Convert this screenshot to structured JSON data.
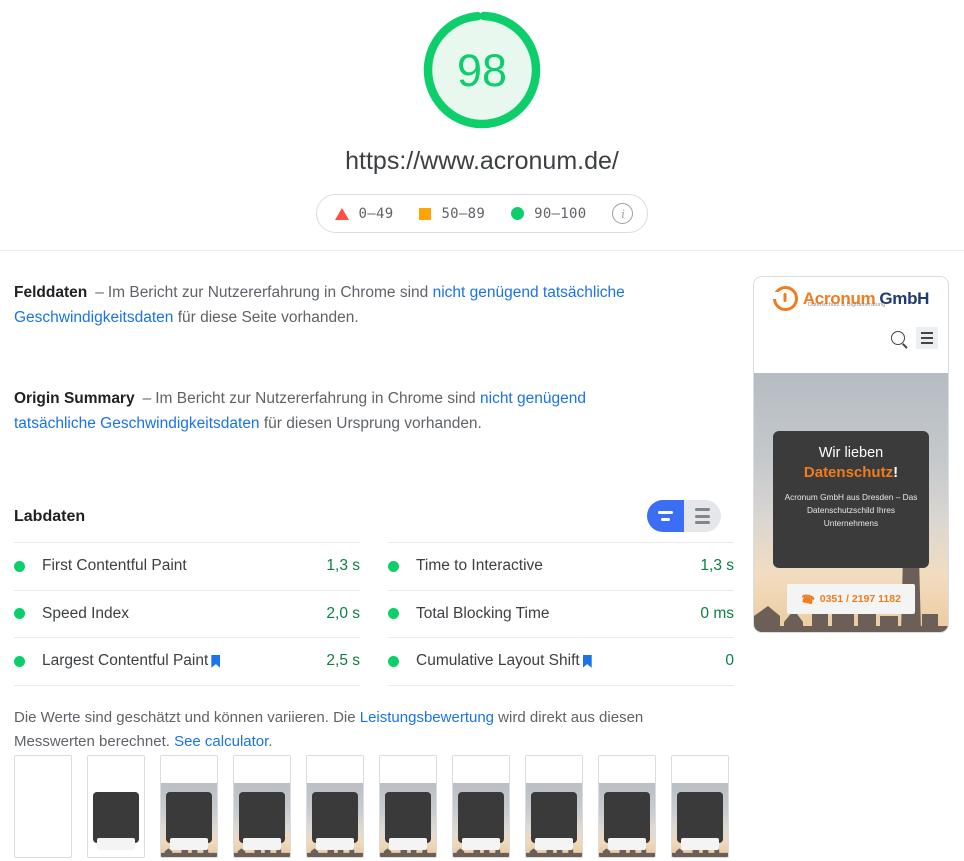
{
  "header": {
    "score": "98",
    "score_color": "#0cce6b",
    "score_bg": "#e8f8ef",
    "url": "https://www.acronum.de/",
    "legend": [
      {
        "icon": "triangle-red-icon",
        "label": "0–49",
        "color": "#ff4e42"
      },
      {
        "icon": "square-orange-icon",
        "label": "50–89",
        "color": "#ffa400"
      },
      {
        "icon": "circle-green-icon",
        "label": "90–100",
        "color": "#0cce6b"
      }
    ],
    "info_icon": "i"
  },
  "field_data": {
    "title": "Felddaten",
    "dash": "–",
    "text_1": "Im Bericht zur Nutzererfahrung in Chrome sind ",
    "link_1": "nicht genügend tatsächliche Geschwindigkeitsdaten",
    "text_2": " für diese Seite vorhanden."
  },
  "origin_summary": {
    "title": "Origin Summary",
    "dash": "–",
    "text_1": "Im Bericht zur Nutzererfahrung in Chrome sind ",
    "link_1": "nicht genügend tatsächliche Geschwindigkeitsdaten",
    "text_2": " für diesen Ursprung vorhanden."
  },
  "lab_data": {
    "title": "Labdaten",
    "toggle": {
      "active": "compact-view",
      "left_label": "compact-view-toggle",
      "right_label": "expanded-view-toggle"
    },
    "metrics_left": [
      {
        "name": "First Contentful Paint",
        "value": "1,3 s",
        "status": "green",
        "bookmark": false
      },
      {
        "name": "Speed Index",
        "value": "2,0 s",
        "status": "green",
        "bookmark": false
      },
      {
        "name": "Largest Contentful Paint",
        "value": "2,5 s",
        "status": "green",
        "bookmark": true
      }
    ],
    "metrics_right": [
      {
        "name": "Time to Interactive",
        "value": "1,3 s",
        "status": "green",
        "bookmark": false
      },
      {
        "name": "Total Blocking Time",
        "value": "0 ms",
        "status": "green",
        "bookmark": false
      },
      {
        "name": "Cumulative Layout Shift",
        "value": "0",
        "status": "green",
        "bookmark": true
      }
    ]
  },
  "footnote": {
    "text_1": "Die Werte sind geschätzt und können variieren. Die ",
    "link_1": "Leistungsbewertung",
    "text_2": " wird direkt aus diesen Messwerten berechnet. ",
    "link_2": "See calculator",
    "text_3": "."
  },
  "screenshot": {
    "logo_main": "Acronum",
    "logo_suffix": "GmbH",
    "logo_tagline": "Datenschutz & Digitalberatung",
    "search_icon": "search-icon",
    "menu_icon": "hamburger-menu-icon",
    "hero_line1": "Wir lieben",
    "hero_line2": "Datenschutz",
    "hero_line2_mark": "!",
    "hero_body": "Acronum GmbH aus Dresden – Das Datenschutzschild Ihres Unternehmens",
    "phone_icon": "phone-icon",
    "phone": "0351 / 2197 1182"
  },
  "filmstrip": {
    "frames": [
      {
        "state": "blank"
      },
      {
        "state": "white"
      },
      {
        "state": "full"
      },
      {
        "state": "full"
      },
      {
        "state": "full"
      },
      {
        "state": "full"
      },
      {
        "state": "full"
      },
      {
        "state": "full"
      },
      {
        "state": "full"
      },
      {
        "state": "full"
      }
    ]
  },
  "colors": {
    "green": "#0cce6b",
    "green_text": "#0b8043",
    "orange": "#ffa400",
    "red": "#ff4e42",
    "link_blue": "#1a73e8",
    "toggle_blue": "#3b6ef5",
    "brand_orange": "#f07c1e",
    "brand_navy": "#1f3b73"
  }
}
